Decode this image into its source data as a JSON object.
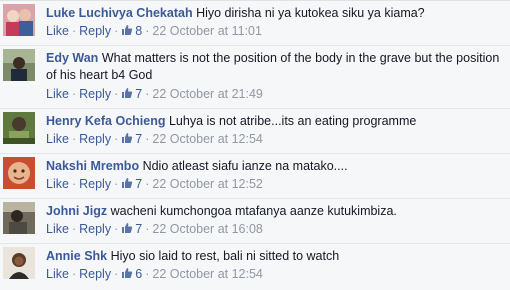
{
  "labels": {
    "like": "Like",
    "reply": "Reply",
    "separator": "·"
  },
  "comments": [
    {
      "author": "Luke Luchivya Chekatah",
      "text": "Hiyo dirisha ni ya kutokea siku ya kiama?",
      "likes": "8",
      "time": "22 October at 11:01",
      "avatar_icon": "profile-photo"
    },
    {
      "author": "Edy Wan",
      "text": "What matters is not the position of the body in the grave but the position of his heart b4 God",
      "likes": "7",
      "time": "22 October at 21:49",
      "avatar_icon": "profile-photo"
    },
    {
      "author": "Henry Kefa Ochieng",
      "text": "Luhya is not atribe...its an eating programme",
      "likes": "7",
      "time": "22 October at 12:54",
      "avatar_icon": "profile-photo"
    },
    {
      "author": "Nakshi Mrembo",
      "text": "Ndio atleast siafu ianze na matako....",
      "likes": "7",
      "time": "22 October at 12:52",
      "avatar_icon": "profile-photo"
    },
    {
      "author": "Johni Jigz",
      "text": "wacheni kumchongoa mtafanya aanze kutukimbiza.",
      "likes": "7",
      "time": "22 October at 16:08",
      "avatar_icon": "profile-photo"
    },
    {
      "author": "Annie Shk",
      "text": "Hiyo sio laid to rest, bali ni sitted to watch",
      "likes": "6",
      "time": "22 October at 12:54",
      "avatar_icon": "profile-photo"
    }
  ],
  "colors": {
    "link": "#3b5998",
    "meta": "#9197a3",
    "text": "#141823",
    "background": "#f6f7f9"
  }
}
